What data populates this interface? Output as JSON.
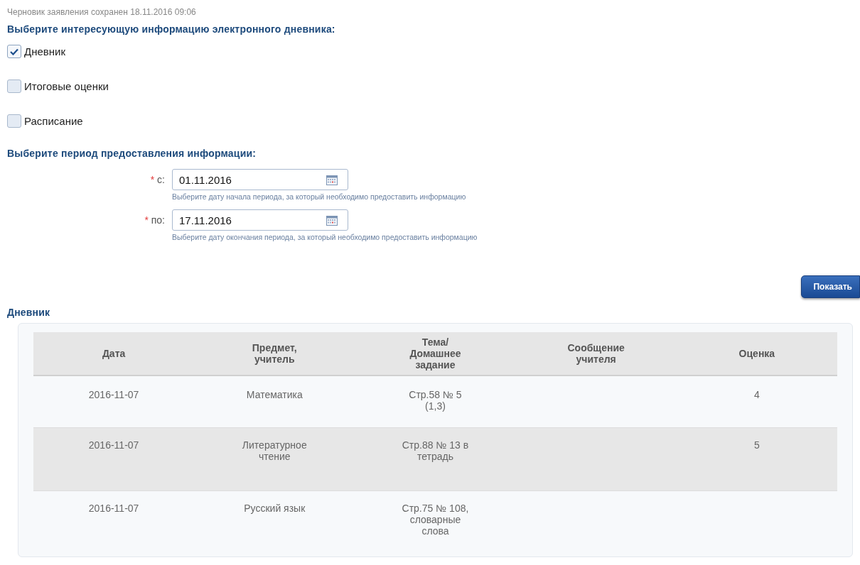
{
  "draft_notice": "Черновик заявления сохранен 18.11.2016 09:06",
  "info_heading": "Выберите интересующую информацию электронного дневника:",
  "options": [
    {
      "label": "Дневник",
      "checked": true
    },
    {
      "label": "Итоговые оценки",
      "checked": false
    },
    {
      "label": "Расписание",
      "checked": false
    }
  ],
  "period_heading": "Выберите период предоставления информации:",
  "date_fields": [
    {
      "required_mark": "*",
      "label": "с:",
      "value": "01.11.2016",
      "hint": "Выберите дату начала периода, за который необходимо предоставить информацию"
    },
    {
      "required_mark": "*",
      "label": "по:",
      "value": "17.11.2016",
      "hint": "Выберите дату окончания периода, за который необходимо предоставить информацию"
    }
  ],
  "show_button": "Показать",
  "diary_heading": "Дневник",
  "table": {
    "columns": [
      "Дата",
      "Предмет, учитель",
      "Тема/Домашнее задание",
      "Сообщение учителя",
      "Оценка"
    ],
    "rows": [
      [
        "2016-11-07",
        "Математика",
        "Стр.58 № 5 (1,3)",
        "",
        "4"
      ],
      [
        "2016-11-07",
        "Литературное чтение",
        "Стр.88 № 13 в тетрадь",
        "",
        "5"
      ],
      [
        "2016-11-07",
        "Русский язык",
        "Стр.75 № 108, словарные слова",
        "",
        ""
      ]
    ]
  }
}
